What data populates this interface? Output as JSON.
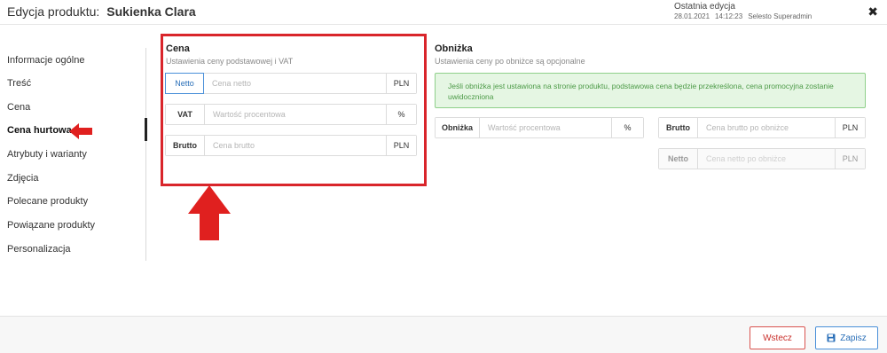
{
  "header": {
    "label": "Edycja produktu:",
    "product_name": "Sukienka Clara",
    "last_edit_title": "Ostatnia edycja",
    "last_edit_date": "28.01.2021",
    "last_edit_time": "14:12:23",
    "last_edit_user": "Selesto Superadmin",
    "close_icon": "close-icon"
  },
  "sidebar": {
    "items": [
      {
        "label": "Informacje ogólne"
      },
      {
        "label": "Treść"
      },
      {
        "label": "Cena"
      },
      {
        "label": "Cena hurtowa"
      },
      {
        "label": "Atrybuty i warianty"
      },
      {
        "label": "Zdjęcia"
      },
      {
        "label": "Polecane produkty"
      },
      {
        "label": "Powiązane produkty"
      },
      {
        "label": "Personalizacja"
      }
    ],
    "active": "Cena hurtowa"
  },
  "price": {
    "title": "Cena",
    "subtitle": "Ustawienia ceny podstawowej i VAT",
    "netto": {
      "label": "Netto",
      "placeholder": "Cena netto",
      "unit": "PLN"
    },
    "vat": {
      "label": "VAT",
      "placeholder": "Wartość procentowa",
      "unit": "%"
    },
    "brutto": {
      "label": "Brutto",
      "placeholder": "Cena brutto",
      "unit": "PLN"
    }
  },
  "discount": {
    "title": "Obniżka",
    "subtitle": "Ustawienia ceny po obniżce są opcjonalne",
    "alert": "Jeśli obniżka jest ustawiona na stronie produktu, podstawowa cena będzie przekreślona, cena promocyjna zostanie uwidoczniona",
    "obnizka": {
      "label": "Obniżka",
      "placeholder": "Wartość procentowa",
      "unit": "%"
    },
    "brutto": {
      "label": "Brutto",
      "placeholder": "Cena brutto po obniżce",
      "unit": "PLN"
    },
    "netto": {
      "label": "Netto",
      "placeholder": "Cena netto po obniżce",
      "unit": "PLN"
    }
  },
  "footer": {
    "back_label": "Wstecz",
    "save_label": "Zapisz"
  },
  "colors": {
    "annotation_red": "#d9252b",
    "accent_blue": "#4a90d9",
    "alert_green": "#4c9a47"
  }
}
